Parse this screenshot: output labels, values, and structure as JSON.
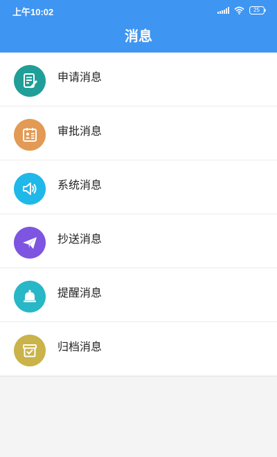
{
  "status_bar": {
    "time": "上午10:02",
    "battery": "25"
  },
  "header": {
    "title": "消息"
  },
  "colors": {
    "header_bg": "#3f95f2",
    "application_icon": "#1f9f97",
    "approval_icon": "#e39a55",
    "system_icon": "#1fb8e8",
    "cc_icon": "#7d55e0",
    "reminder_icon": "#27b7c7",
    "archive_icon": "#c9b34a"
  },
  "messages": [
    {
      "label": "申请消息",
      "icon": "edit-document-icon"
    },
    {
      "label": "审批消息",
      "icon": "id-card-icon"
    },
    {
      "label": "系统消息",
      "icon": "speaker-icon"
    },
    {
      "label": "抄送消息",
      "icon": "paper-plane-icon"
    },
    {
      "label": "提醒消息",
      "icon": "bell-icon"
    },
    {
      "label": "归档消息",
      "icon": "archive-box-icon"
    }
  ]
}
